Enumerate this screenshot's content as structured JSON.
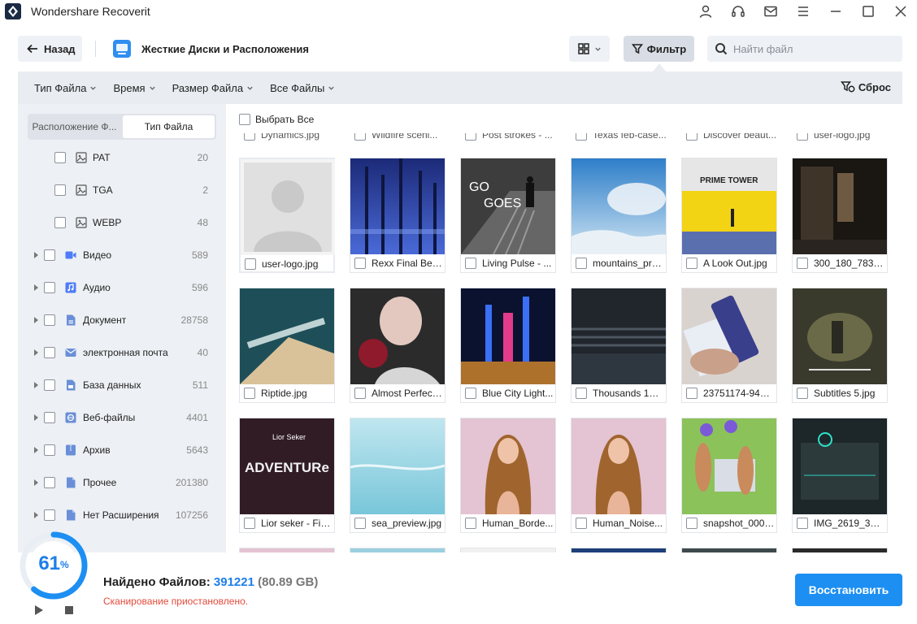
{
  "app": {
    "title": "Wondershare Recoverit"
  },
  "titlebar_icons": [
    "user-icon",
    "headset-icon",
    "mail-icon",
    "menu-icon",
    "minimize-icon",
    "maximize-icon",
    "close-icon"
  ],
  "toolbar": {
    "back_label": "Назад",
    "location_title": "Жесткие Диски и Расположения",
    "filter_label": "Фильтр",
    "search_placeholder": "Найти файл"
  },
  "filter_bar": {
    "items": [
      "Тип Файла",
      "Время",
      "Размер Файла",
      "Все Файлы"
    ],
    "reset_label": "Сброс"
  },
  "left_panel": {
    "tabs": [
      "Расположение Ф...",
      "Тип Файла"
    ],
    "active_tab": 1,
    "sub_items": [
      {
        "label": "PAT",
        "count": "20"
      },
      {
        "label": "TGA",
        "count": "2"
      },
      {
        "label": "WEBP",
        "count": "48"
      }
    ],
    "categories": [
      {
        "label": "Видео",
        "count": "589",
        "icon": "video-icon",
        "color": "#4e7cf6"
      },
      {
        "label": "Аудио",
        "count": "596",
        "icon": "audio-icon",
        "color": "#4e7cf6"
      },
      {
        "label": "Документ",
        "count": "28758",
        "icon": "document-icon",
        "color": "#6a8fd8"
      },
      {
        "label": "электронная почта",
        "count": "40",
        "icon": "email-icon",
        "color": "#6a8fd8"
      },
      {
        "label": "База данных",
        "count": "511",
        "icon": "database-icon",
        "color": "#6a8fd8"
      },
      {
        "label": "Веб-файлы",
        "count": "4401",
        "icon": "web-icon",
        "color": "#6a8fd8"
      },
      {
        "label": "Архив",
        "count": "5643",
        "icon": "archive-icon",
        "color": "#6a8fd8"
      },
      {
        "label": "Прочее",
        "count": "201380",
        "icon": "other-icon",
        "color": "#6a8fd8"
      },
      {
        "label": "Нет Расширения",
        "count": "107256",
        "icon": "noext-icon",
        "color": "#6a8fd8"
      }
    ]
  },
  "grid": {
    "select_all_label": "Выбрать Все",
    "partial_top": [
      "Dynamics.jpg",
      "Wildfire sceni...",
      "Post strokes - ...",
      "Texas feb-case...",
      "Discover beaut...",
      "user-logo.jpg"
    ],
    "files": [
      "user-logo.jpg",
      "Rexx Final Beat...",
      "Living Pulse - ...",
      "mountains_pre...",
      "A Look Out.jpg",
      "300_180_78360...",
      "Riptide.jpg",
      "Almost Perfect...",
      "Blue City Light...",
      "Thousands 15.j...",
      "23751174-94bb...",
      "Subtitles 5.jpg",
      "Lior seker - Firs...",
      "sea_preview.jpg",
      "Human_Borde...",
      "Human_Noise...",
      "snapshot_0000...",
      "IMG_2619_392..."
    ],
    "thumb_texts": {
      "go_goes_1": "GO",
      "go_goes_2": "GOES",
      "prime_tower": "PRIME TOWER",
      "adventure": "ADVENTURe",
      "lior": "Lior Seker"
    }
  },
  "status": {
    "percent": "61",
    "progress": 0.61,
    "found_label": "Найдено Файлов:",
    "found_count": "391221",
    "found_size": "(80.89 GB)",
    "scan_status": "Сканирование приостановлено.",
    "recover_label": "Восстановить"
  },
  "colors": {
    "accent": "#1d8ff2",
    "percent": "#1d7ee8",
    "warning": "#e24a3b"
  }
}
